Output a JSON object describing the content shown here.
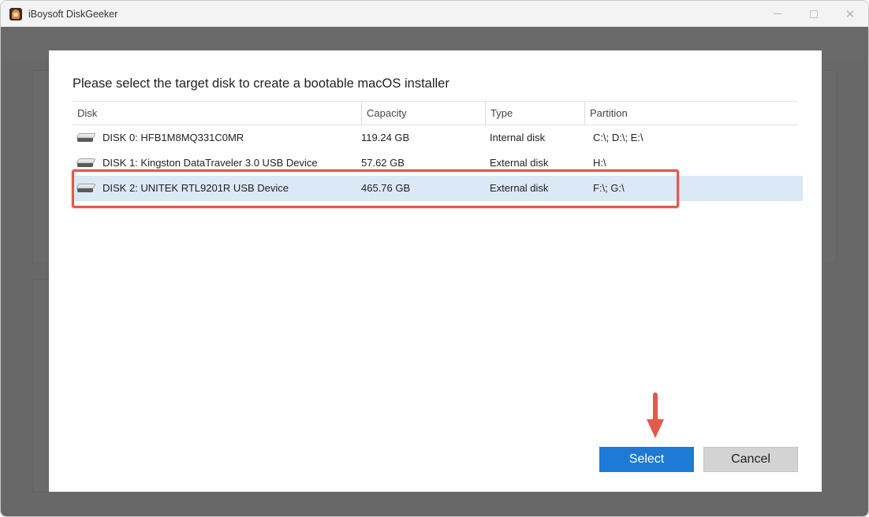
{
  "window": {
    "title": "iBoysoft DiskGeeker",
    "icons": {
      "logo": "app-logo",
      "minimize": "minimize-icon",
      "maximize": "maximize-icon",
      "close": "close-icon"
    }
  },
  "dialog": {
    "title": "Please select the target disk to create a bootable macOS installer",
    "columns": [
      "Disk",
      "Capacity",
      "Type",
      "Partition"
    ],
    "rows": [
      {
        "disk": "DISK 0: HFB1M8MQ331C0MR",
        "capacity": "119.24 GB",
        "type": "Internal disk",
        "partition": "C:\\; D:\\; E:\\"
      },
      {
        "disk": "DISK 1: Kingston DataTraveler 3.0 USB Device",
        "capacity": "57.62 GB",
        "type": "External disk",
        "partition": "H:\\"
      },
      {
        "disk": "DISK 2: UNITEK RTL9201R USB Device",
        "capacity": "465.76 GB",
        "type": "External disk",
        "partition": "F:\\; G:\\"
      }
    ],
    "selected_row": 2,
    "select_label": "Select",
    "cancel_label": "Cancel"
  },
  "colors": {
    "accent": "#1e7ad6",
    "selection": "#dbe8f5",
    "annotation": "#e25a4d"
  }
}
